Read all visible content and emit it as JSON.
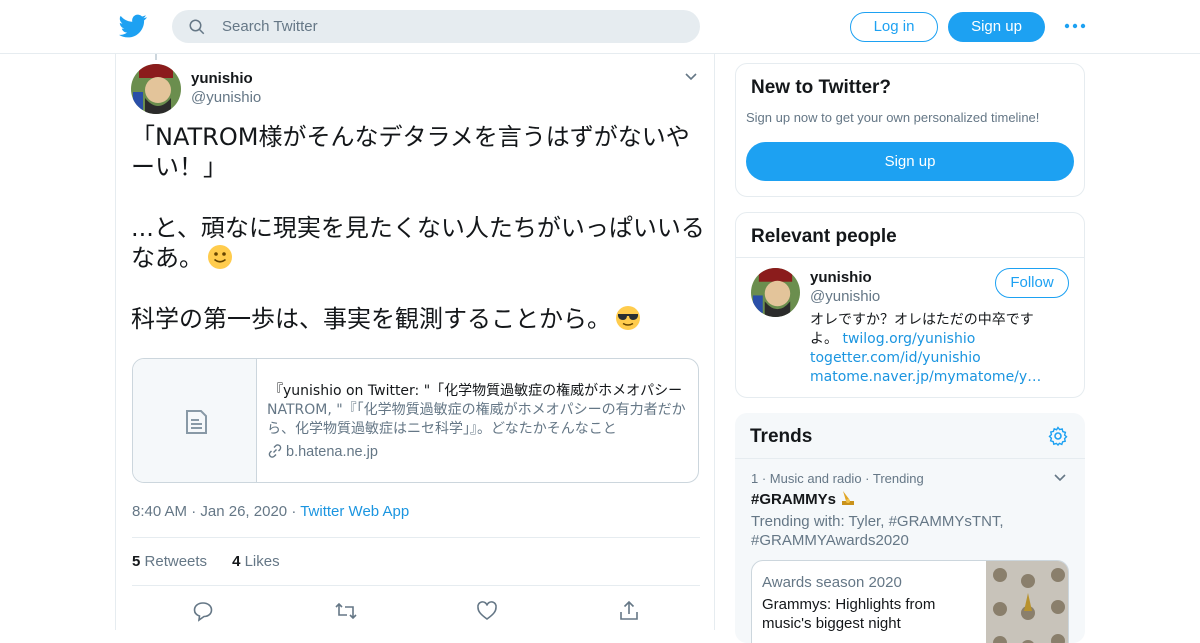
{
  "header": {
    "search_placeholder": "Search Twitter",
    "login_label": "Log in",
    "signup_label": "Sign up"
  },
  "tweet": {
    "author_name": "yunishio",
    "author_handle": "@yunishio",
    "text_1": "「NATROM様がそんなデタラメを言うはずがないやーい！」",
    "text_2": "...と、頑なに現実を見たくない人たちがいっぱいいるなあ。",
    "text_3": "科学の第一歩は、事実を観測することから。",
    "card": {
      "title": "『yunishio on Twitter: \"「化学物質過敏症の権威がホメオパシー",
      "description": "NATROM, \"『「化学物質過敏症の権威がホメオパシーの有力者だから、化学物質過敏症はニセ科学」』。どなたかそんなこと",
      "domain": "b.hatena.ne.jp"
    },
    "time": "8:40 AM",
    "date": "Jan 26, 2020",
    "source": "Twitter Web App",
    "retweets_count": "5",
    "retweets_label": "Retweets",
    "likes_count": "4",
    "likes_label": "Likes"
  },
  "new_to_twitter": {
    "title": "New to Twitter?",
    "subtitle": "Sign up now to get your own personalized timeline!",
    "button": "Sign up"
  },
  "relevant_people": {
    "title": "Relevant people",
    "name": "yunishio",
    "handle": "@yunishio",
    "follow_label": "Follow",
    "bio": "オレですか？オレはただの中卒ですよ。",
    "links": [
      "twilog.org/yunishio",
      "togetter.com/id/yunishio",
      "matome.naver.jp/mymatome/yunishio"
    ]
  },
  "trends": {
    "title": "Trends",
    "meta": "1 · Music and radio · Trending",
    "hashtag": "#GRAMMYs",
    "trending_with": "Trending with: Tyler, #GRAMMYsTNT, #GRAMMYAwards2020",
    "card_season": "Awards season 2020",
    "card_headline": "Grammys: Highlights from music's biggest night"
  },
  "colors": {
    "brand_blue": "#1da1f2",
    "link_blue": "#1b95e0",
    "muted_gray": "#657786",
    "border": "#e6ecf0"
  }
}
